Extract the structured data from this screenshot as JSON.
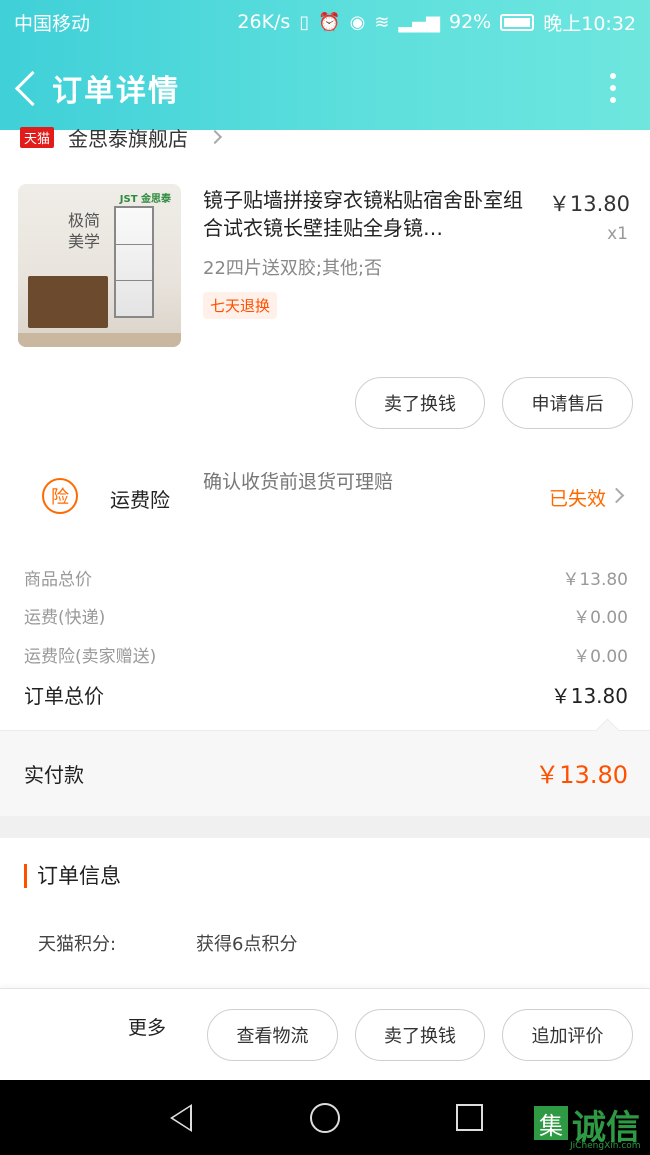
{
  "status_bar": {
    "carrier": "中国移动",
    "speed": "26K/s",
    "battery": "92%",
    "time": "晚上10:32"
  },
  "header": {
    "title": "订单详情"
  },
  "store": {
    "badge": "天猫",
    "name": "金思泰旗舰店"
  },
  "product": {
    "image_brand": "JST 金思泰",
    "image_slogan": "极简美学",
    "title": "镜子贴墙拼接穿衣镜粘贴宿舍卧室组合试衣镜长壁挂贴全身镜…",
    "price": "￥13.80",
    "quantity": "x1",
    "sku": "22四片送双胶;其他;否",
    "tag": "七天退换"
  },
  "product_actions": {
    "sell": "卖了换钱",
    "after_sales": "申请售后"
  },
  "insurance": {
    "icon_char": "险",
    "label": "运费险",
    "desc": "确认收货前退货可理赔",
    "status": "已失效"
  },
  "summary": {
    "goods_label": "商品总价",
    "goods_value": "￥13.80",
    "shipping_label": "运费(快递)",
    "shipping_value": "￥0.00",
    "insurance_label": "运费险(卖家赠送)",
    "insurance_value": "￥0.00",
    "total_label": "订单总价",
    "total_value": "￥13.80",
    "paid_label": "实付款",
    "paid_value": "￥13.80"
  },
  "order_info": {
    "title": "订单信息",
    "points_label": "天猫积分:",
    "points_value": "获得6点积分"
  },
  "bottom_bar": {
    "more": "更多",
    "logistics": "查看物流",
    "sell": "卖了换钱",
    "review": "追加评价"
  },
  "watermark": {
    "char": "集",
    "text": "诚信",
    "url": "JiChengXin.com"
  },
  "colors": {
    "accent": "#ff5000",
    "header": "#4fd8da",
    "insurance": "#ff6a00"
  }
}
